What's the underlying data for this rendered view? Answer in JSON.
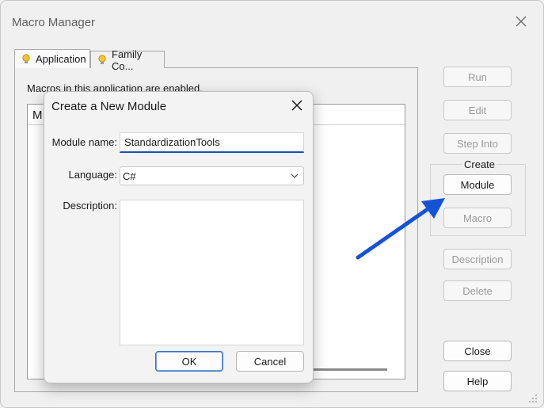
{
  "window": {
    "title": "Macro Manager"
  },
  "tabs": [
    {
      "label": "Application",
      "icon": "lightbulb-icon",
      "active": true
    },
    {
      "label": "Family Co...",
      "icon": "lightbulb-icon",
      "active": false
    }
  ],
  "panel": {
    "enabled_text": "Macros in this application are enabled.",
    "list_column_letter": "M"
  },
  "actions": {
    "run": "Run",
    "edit": "Edit",
    "step_into": "Step Into",
    "create_group": "Create",
    "module": "Module",
    "macro": "Macro",
    "description": "Description",
    "delete": "Delete",
    "close": "Close",
    "help": "Help"
  },
  "dialog": {
    "title": "Create a New Module",
    "module_name_label": "Module name:",
    "module_name_value": "StandardizationTools",
    "language_label": "Language:",
    "language_value": "C#",
    "description_label": "Description:",
    "description_value": "",
    "ok": "OK",
    "cancel": "Cancel"
  },
  "colors": {
    "accent": "#1f4fb0",
    "annotation_arrow": "#1553d6"
  }
}
